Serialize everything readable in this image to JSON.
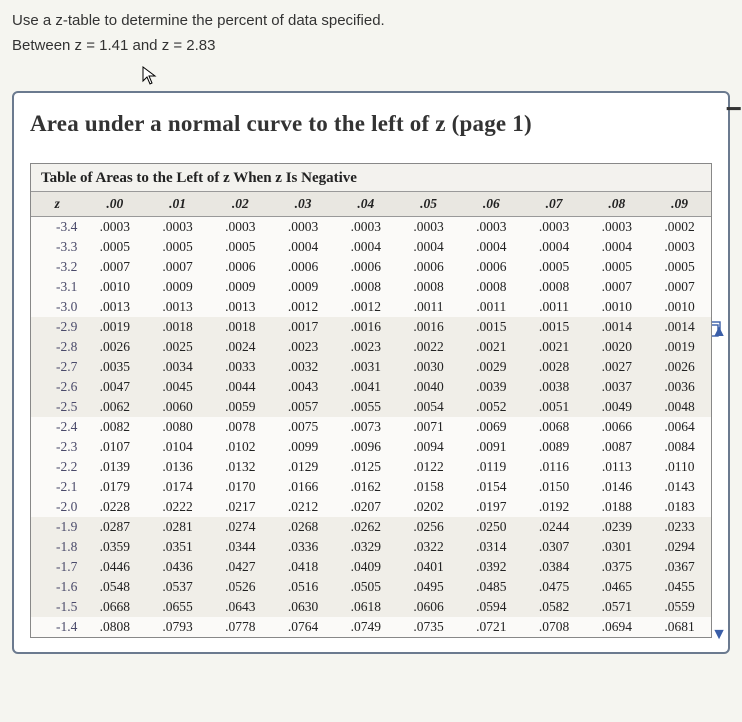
{
  "question": {
    "line1": "Use a z-table to determine the percent of data specified.",
    "line2": "Between z = 1.41 and z = 2.83"
  },
  "panel": {
    "title": "Area under a normal curve to the left of z (page 1)"
  },
  "table": {
    "caption": "Table of Areas to the Left of z When z Is Negative",
    "headers": [
      "z",
      ".00",
      ".01",
      ".02",
      ".03",
      ".04",
      ".05",
      ".06",
      ".07",
      ".08",
      ".09"
    ],
    "rows": [
      {
        "z": "-3.4",
        "v": [
          ".0003",
          ".0003",
          ".0003",
          ".0003",
          ".0003",
          ".0003",
          ".0003",
          ".0003",
          ".0003",
          ".0002"
        ]
      },
      {
        "z": "-3.3",
        "v": [
          ".0005",
          ".0005",
          ".0005",
          ".0004",
          ".0004",
          ".0004",
          ".0004",
          ".0004",
          ".0004",
          ".0003"
        ]
      },
      {
        "z": "-3.2",
        "v": [
          ".0007",
          ".0007",
          ".0006",
          ".0006",
          ".0006",
          ".0006",
          ".0006",
          ".0005",
          ".0005",
          ".0005"
        ]
      },
      {
        "z": "-3.1",
        "v": [
          ".0010",
          ".0009",
          ".0009",
          ".0009",
          ".0008",
          ".0008",
          ".0008",
          ".0008",
          ".0007",
          ".0007"
        ]
      },
      {
        "z": "-3.0",
        "v": [
          ".0013",
          ".0013",
          ".0013",
          ".0012",
          ".0012",
          ".0011",
          ".0011",
          ".0011",
          ".0010",
          ".0010"
        ]
      },
      {
        "z": "-2.9",
        "v": [
          ".0019",
          ".0018",
          ".0018",
          ".0017",
          ".0016",
          ".0016",
          ".0015",
          ".0015",
          ".0014",
          ".0014"
        ]
      },
      {
        "z": "-2.8",
        "v": [
          ".0026",
          ".0025",
          ".0024",
          ".0023",
          ".0023",
          ".0022",
          ".0021",
          ".0021",
          ".0020",
          ".0019"
        ]
      },
      {
        "z": "-2.7",
        "v": [
          ".0035",
          ".0034",
          ".0033",
          ".0032",
          ".0031",
          ".0030",
          ".0029",
          ".0028",
          ".0027",
          ".0026"
        ]
      },
      {
        "z": "-2.6",
        "v": [
          ".0047",
          ".0045",
          ".0044",
          ".0043",
          ".0041",
          ".0040",
          ".0039",
          ".0038",
          ".0037",
          ".0036"
        ]
      },
      {
        "z": "-2.5",
        "v": [
          ".0062",
          ".0060",
          ".0059",
          ".0057",
          ".0055",
          ".0054",
          ".0052",
          ".0051",
          ".0049",
          ".0048"
        ]
      },
      {
        "z": "-2.4",
        "v": [
          ".0082",
          ".0080",
          ".0078",
          ".0075",
          ".0073",
          ".0071",
          ".0069",
          ".0068",
          ".0066",
          ".0064"
        ]
      },
      {
        "z": "-2.3",
        "v": [
          ".0107",
          ".0104",
          ".0102",
          ".0099",
          ".0096",
          ".0094",
          ".0091",
          ".0089",
          ".0087",
          ".0084"
        ]
      },
      {
        "z": "-2.2",
        "v": [
          ".0139",
          ".0136",
          ".0132",
          ".0129",
          ".0125",
          ".0122",
          ".0119",
          ".0116",
          ".0113",
          ".0110"
        ]
      },
      {
        "z": "-2.1",
        "v": [
          ".0179",
          ".0174",
          ".0170",
          ".0166",
          ".0162",
          ".0158",
          ".0154",
          ".0150",
          ".0146",
          ".0143"
        ]
      },
      {
        "z": "-2.0",
        "v": [
          ".0228",
          ".0222",
          ".0217",
          ".0212",
          ".0207",
          ".0202",
          ".0197",
          ".0192",
          ".0188",
          ".0183"
        ]
      },
      {
        "z": "-1.9",
        "v": [
          ".0287",
          ".0281",
          ".0274",
          ".0268",
          ".0262",
          ".0256",
          ".0250",
          ".0244",
          ".0239",
          ".0233"
        ]
      },
      {
        "z": "-1.8",
        "v": [
          ".0359",
          ".0351",
          ".0344",
          ".0336",
          ".0329",
          ".0322",
          ".0314",
          ".0307",
          ".0301",
          ".0294"
        ]
      },
      {
        "z": "-1.7",
        "v": [
          ".0446",
          ".0436",
          ".0427",
          ".0418",
          ".0409",
          ".0401",
          ".0392",
          ".0384",
          ".0375",
          ".0367"
        ]
      },
      {
        "z": "-1.6",
        "v": [
          ".0548",
          ".0537",
          ".0526",
          ".0516",
          ".0505",
          ".0495",
          ".0485",
          ".0475",
          ".0465",
          ".0455"
        ]
      },
      {
        "z": "-1.5",
        "v": [
          ".0668",
          ".0655",
          ".0643",
          ".0630",
          ".0618",
          ".0606",
          ".0594",
          ".0582",
          ".0571",
          ".0559"
        ]
      },
      {
        "z": "-1.4",
        "v": [
          ".0808",
          ".0793",
          ".0778",
          ".0764",
          ".0749",
          ".0735",
          ".0721",
          ".0708",
          ".0694",
          ".0681"
        ]
      }
    ]
  },
  "icons": {
    "minus_label": "−",
    "scroll_up": "▲",
    "scroll_down": "▼"
  }
}
